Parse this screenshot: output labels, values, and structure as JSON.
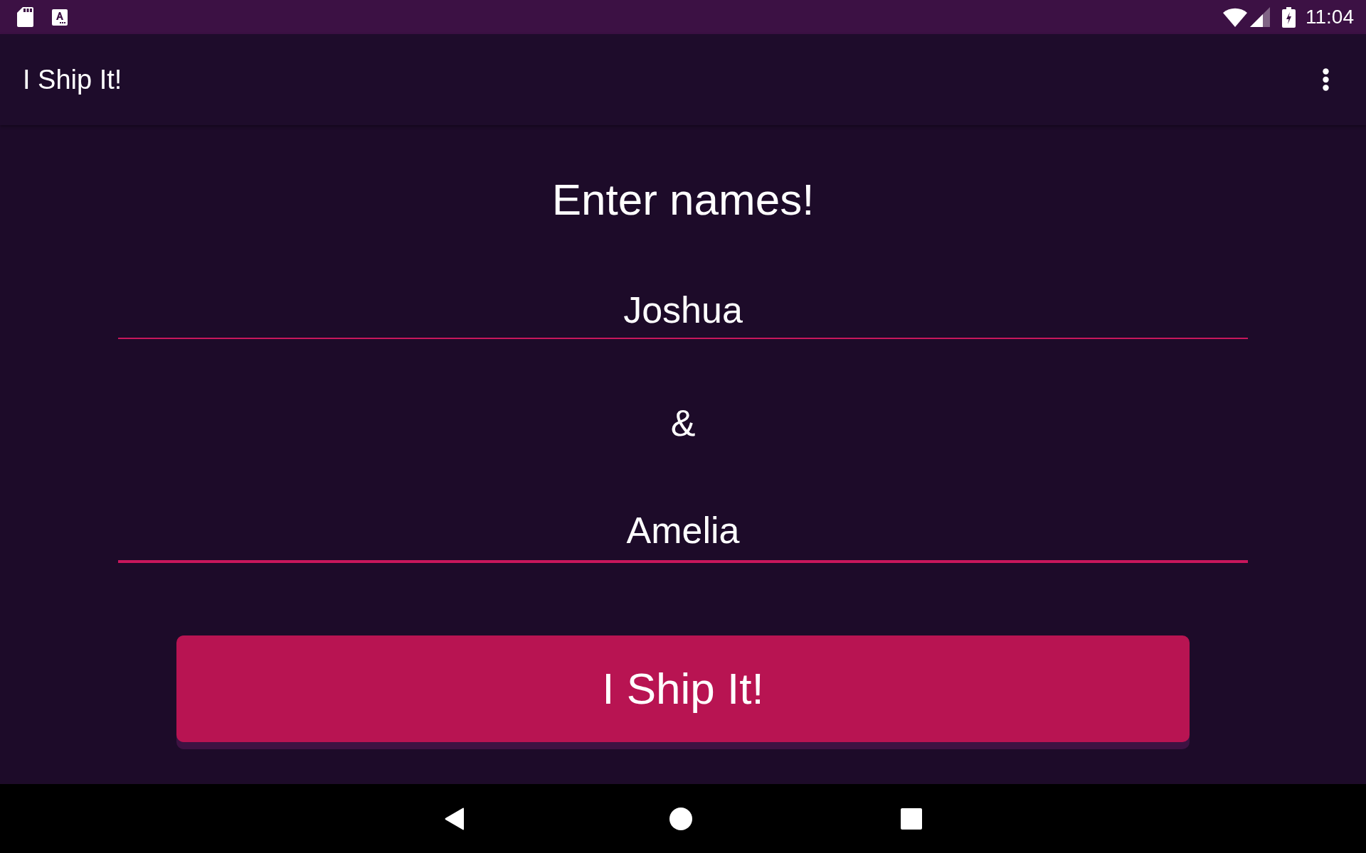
{
  "status_bar": {
    "time": "11:04"
  },
  "app_bar": {
    "title": "I Ship It!"
  },
  "form": {
    "heading": "Enter names!",
    "items": [
      {
        "kind": "field",
        "value": "Joshua",
        "focused": false
      },
      {
        "kind": "separator",
        "text": "&"
      },
      {
        "kind": "field",
        "value": "Amelia",
        "focused": true
      }
    ],
    "submit_button": {
      "label": "I Ship It!"
    }
  }
}
